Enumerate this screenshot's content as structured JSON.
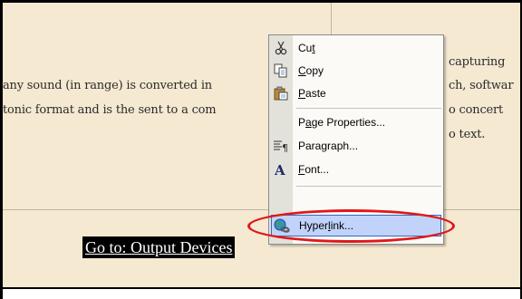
{
  "document": {
    "lines": [
      "any sound (in range) is converted in",
      "tonic format and is the sent to a com"
    ],
    "right_lines": [
      "capturing",
      "ch, softwar",
      "o concert",
      "o text."
    ],
    "goto_link": "Go to: Output Devices"
  },
  "context_menu": {
    "items": [
      {
        "pre": "Cu",
        "ul": "t",
        "post": "",
        "icon": "scissors-icon"
      },
      {
        "pre": "",
        "ul": "C",
        "post": "opy",
        "icon": "copy-icon"
      },
      {
        "pre": "",
        "ul": "P",
        "post": "aste",
        "icon": "paste-icon"
      },
      {
        "pre": "P",
        "ul": "a",
        "post": "ge Properties...",
        "icon": ""
      },
      {
        "pre": "Para",
        "ul": "g",
        "post": "raph...",
        "icon": "paragraph-icon"
      },
      {
        "pre": "",
        "ul": "F",
        "post": "ont...",
        "icon": "font-icon"
      },
      {
        "pre": "Hyper",
        "ul": "l",
        "post": "ink...",
        "icon": "hyperlink-globe-icon"
      }
    ],
    "highlighted_item": "Hyperlink..."
  },
  "colors": {
    "page_background": "#f6e9d2",
    "menu_highlight": "#c1d3fb",
    "annotation_oval": "#e01818"
  }
}
